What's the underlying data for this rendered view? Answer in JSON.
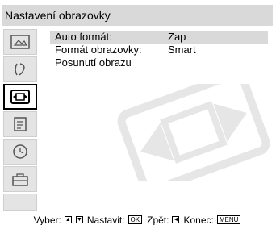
{
  "title": "Nastavení obrazovky",
  "menu": {
    "items": [
      {
        "label": "Auto formát:",
        "value": "Zap"
      },
      {
        "label": "Formát obrazovky:",
        "value": "Smart"
      },
      {
        "label": "Posunutí obrazu",
        "value": ""
      }
    ]
  },
  "footer": {
    "select_label": "Vyber:",
    "select_keys": [
      "▲",
      "▼"
    ],
    "set_label": "Nastavit:",
    "set_key": "OK",
    "back_label": "Zpět:",
    "back_key": "◄",
    "end_label": "Konec:",
    "end_key": "MENU"
  },
  "sidebar": {
    "tabs": [
      {
        "icon": "picture-icon"
      },
      {
        "icon": "sound-icon"
      },
      {
        "icon": "screen-format-icon",
        "active": true
      },
      {
        "icon": "setup-icon"
      },
      {
        "icon": "timer-icon"
      },
      {
        "icon": "toolbox-icon"
      }
    ]
  },
  "colors": {
    "highlight": "#d9d9d9",
    "tab_bg": "#e4e4e4",
    "watermark": "#e6e6e6"
  }
}
